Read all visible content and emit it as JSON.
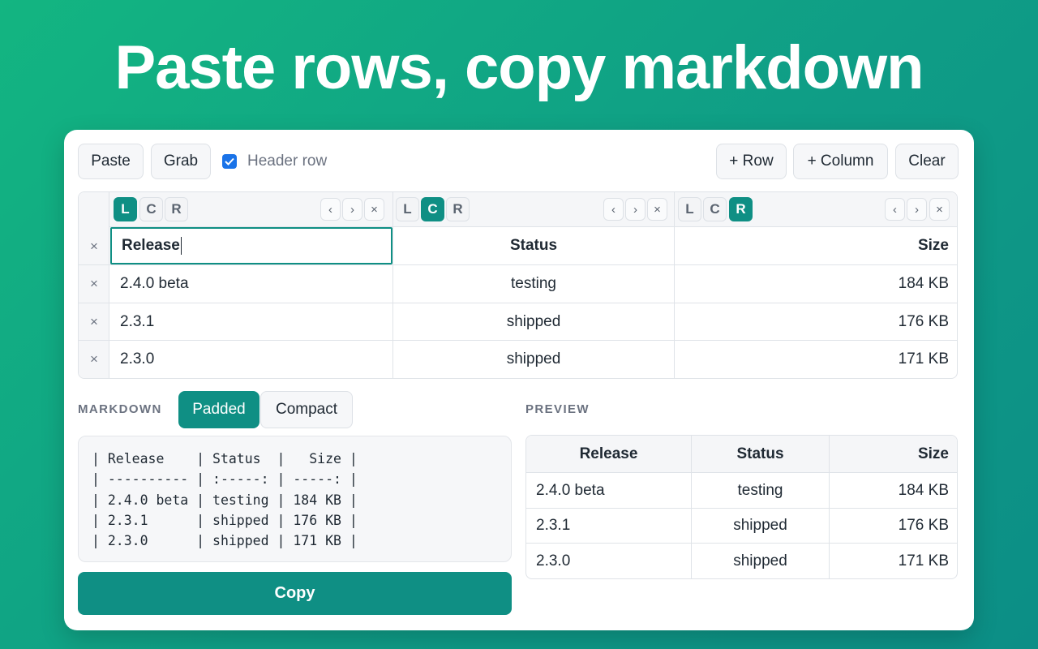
{
  "headline": "Paste rows, copy markdown",
  "toolbar": {
    "paste": "Paste",
    "grab": "Grab",
    "header_row_label": "Header row",
    "header_row_checked": true,
    "add_row": "+ Row",
    "add_column": "+ Column",
    "clear": "Clear"
  },
  "grid": {
    "columns": [
      {
        "align_options": [
          "L",
          "C",
          "R"
        ],
        "active": "L"
      },
      {
        "align_options": [
          "L",
          "C",
          "R"
        ],
        "active": "C"
      },
      {
        "align_options": [
          "L",
          "C",
          "R"
        ],
        "active": "R"
      }
    ],
    "move_left": "‹",
    "move_right": "›",
    "remove": "×",
    "rows": [
      [
        "Release",
        "Status",
        "Size"
      ],
      [
        "2.4.0 beta",
        "testing",
        "184 KB"
      ],
      [
        "2.3.1",
        "shipped",
        "176 KB"
      ],
      [
        "2.3.0",
        "shipped",
        "171 KB"
      ]
    ]
  },
  "markdown": {
    "label": "MARKDOWN",
    "padded": "Padded",
    "compact": "Compact",
    "active_mode": "Padded",
    "output": "| Release    | Status  |   Size |\n| ---------- | :-----: | -----: |\n| 2.4.0 beta | testing | 184 KB |\n| 2.3.1      | shipped | 176 KB |\n| 2.3.0      | shipped | 171 KB |",
    "copy": "Copy"
  },
  "preview": {
    "label": "PREVIEW",
    "headers": [
      "Release",
      "Status",
      "Size"
    ],
    "rows": [
      [
        "2.4.0 beta",
        "testing",
        "184 KB"
      ],
      [
        "2.3.1",
        "shipped",
        "176 KB"
      ],
      [
        "2.3.0",
        "shipped",
        "171 KB"
      ]
    ]
  },
  "colors": {
    "accent": "#0f8f84",
    "checkbox": "#1a73e8"
  }
}
